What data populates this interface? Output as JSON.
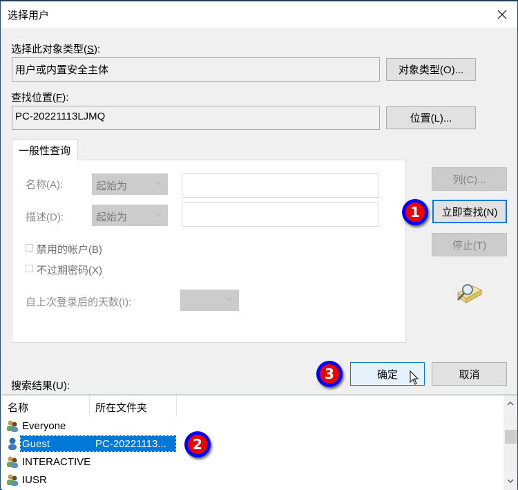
{
  "window": {
    "title": "选择用户",
    "close_icon": "close-icon"
  },
  "object_type": {
    "label": "选择此对象类型",
    "label_accel": "(S)",
    "label_suffix": ":",
    "value": "用户或内置安全主体",
    "button_label": "对象类型(O)..."
  },
  "location": {
    "label": "查找位置",
    "label_accel": "(F)",
    "label_suffix": ":",
    "value": "PC-20221113LJMQ",
    "button_label": "位置(L)..."
  },
  "query_tab": {
    "tab_label": "一般性查询",
    "name_label": "名称(A):",
    "name_match": "起始为",
    "name_value": "",
    "desc_label": "描述(D):",
    "desc_match": "起始为",
    "desc_value": "",
    "disabled_accounts_label": "禁用的帐户(B)",
    "disabled_accounts_checked": false,
    "non_expiring_pw_label": "不过期密码(X)",
    "non_expiring_pw_checked": false,
    "days_since_logon_label": "自上次登录后的天数(I):",
    "days_since_logon_value": ""
  },
  "side_buttons": {
    "columns": "列(C)...",
    "find_now": "立即查找(N)",
    "stop": "停止(T)",
    "search_icon": "search-directory-icon"
  },
  "dialog_buttons": {
    "ok": "确定",
    "cancel": "取消"
  },
  "results": {
    "label": "搜索结果(U):",
    "columns": [
      "名称",
      "所在文件夹"
    ],
    "rows": [
      {
        "name": "Everyone",
        "folder": "",
        "icon": "group-icon",
        "selected": false
      },
      {
        "name": "Guest",
        "folder": "PC-20221113...",
        "icon": "user-icon",
        "selected": true
      },
      {
        "name": "INTERACTIVE",
        "folder": "",
        "icon": "group-icon",
        "selected": false
      },
      {
        "name": "IUSR",
        "folder": "",
        "icon": "group-icon",
        "selected": false
      }
    ]
  },
  "annotations": [
    {
      "number": "1",
      "target": "立即查找(N)"
    },
    {
      "number": "2",
      "target": "Guest"
    },
    {
      "number": "3",
      "target": "确定"
    }
  ],
  "colors": {
    "selection": "#0078d7",
    "badge_outer": "#0000ff",
    "badge_inner": "#ee0000",
    "focus_border": "#0078d7"
  }
}
